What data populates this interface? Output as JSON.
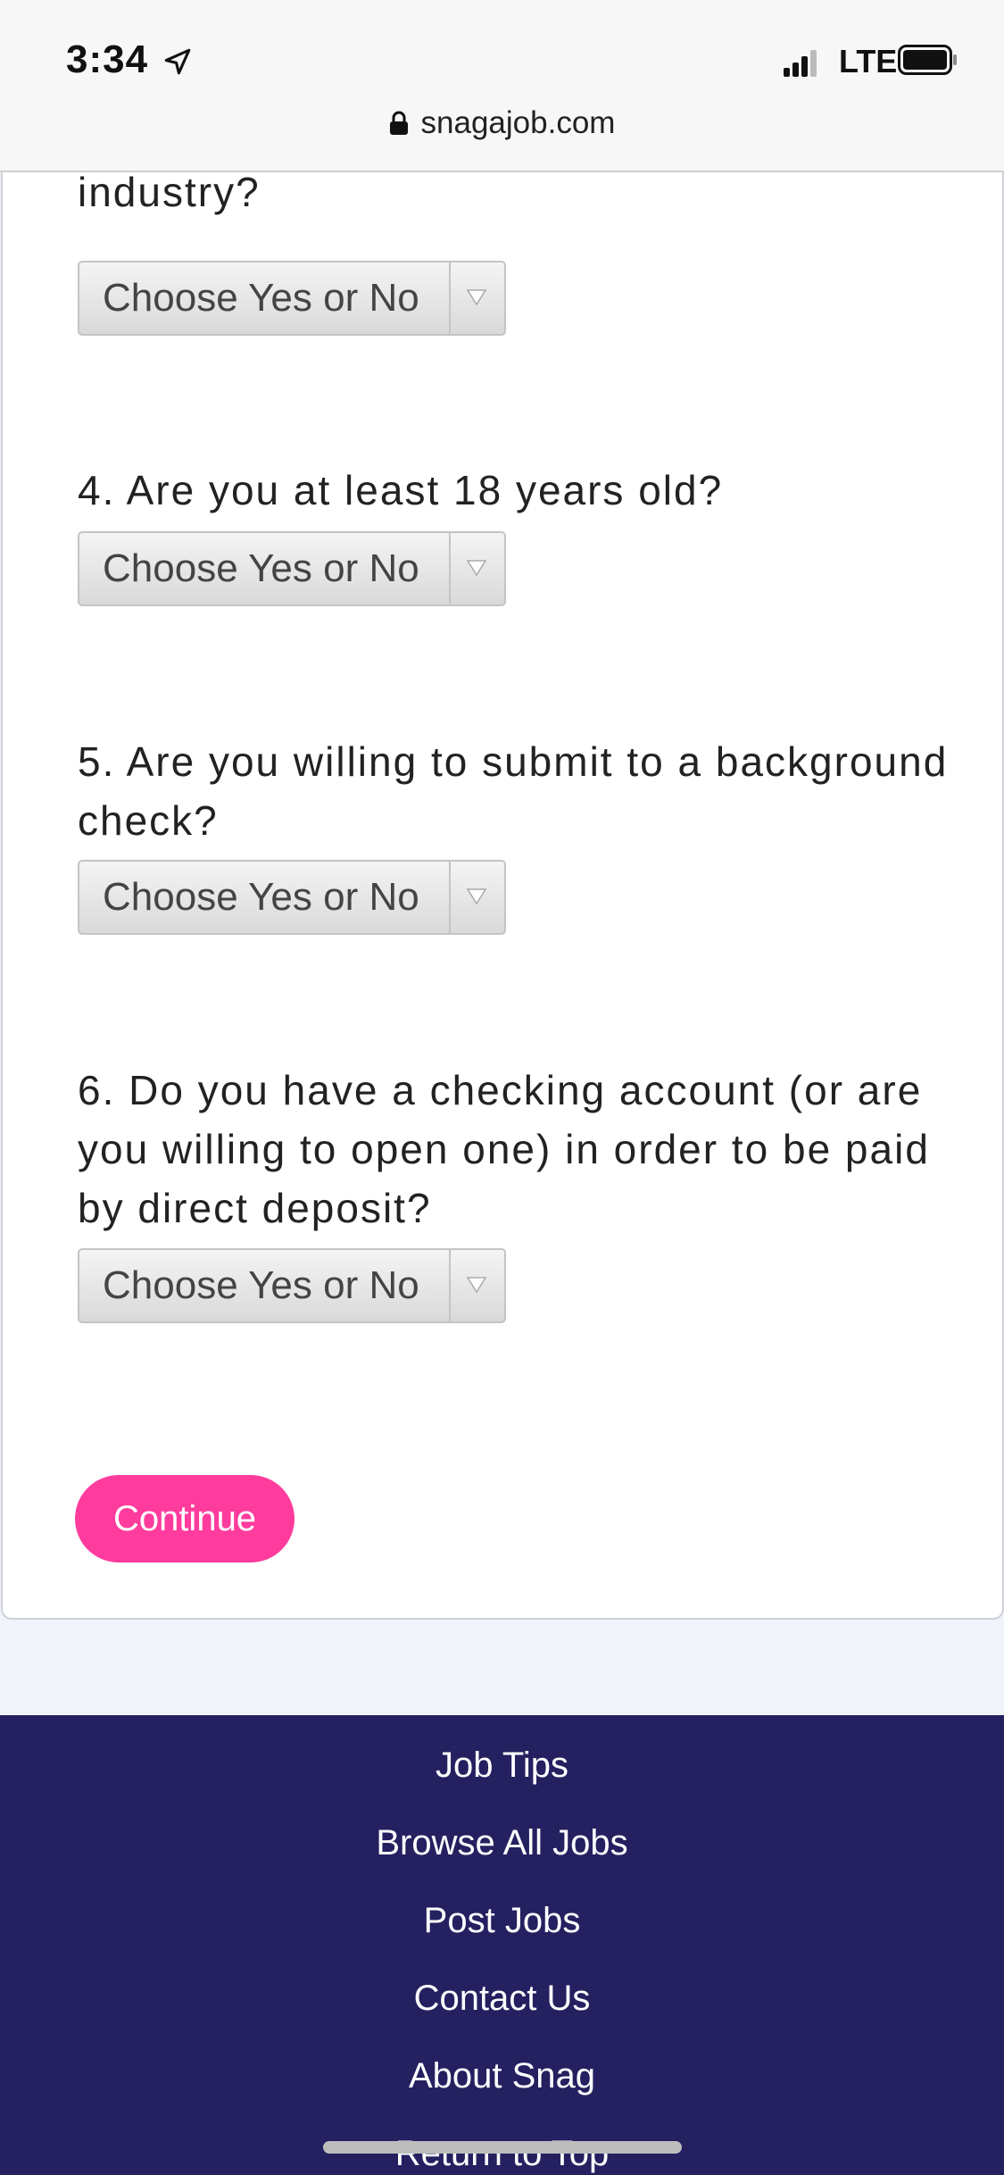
{
  "status_bar": {
    "time": "3:34",
    "network": "LTE"
  },
  "url_bar": {
    "domain": "snagajob.com"
  },
  "form": {
    "q3_tail": "industry?",
    "select_placeholder": "Choose Yes or No",
    "q4": "4. Are you at least 18 years old?",
    "q5": "5. Are you willing to submit to a background check?",
    "q6": "6. Do you have a checking account (or are you willing to open one) in order to be paid by direct deposit?",
    "continue_label": "Continue"
  },
  "footer": {
    "links": [
      "Job Tips",
      "Browse All Jobs",
      "Post Jobs",
      "Contact Us",
      "About Snag",
      "Return to Top"
    ]
  },
  "colors": {
    "accent": "#ff3c9d",
    "footer_bg": "#252060",
    "page_bg": "#f1f3fb"
  }
}
